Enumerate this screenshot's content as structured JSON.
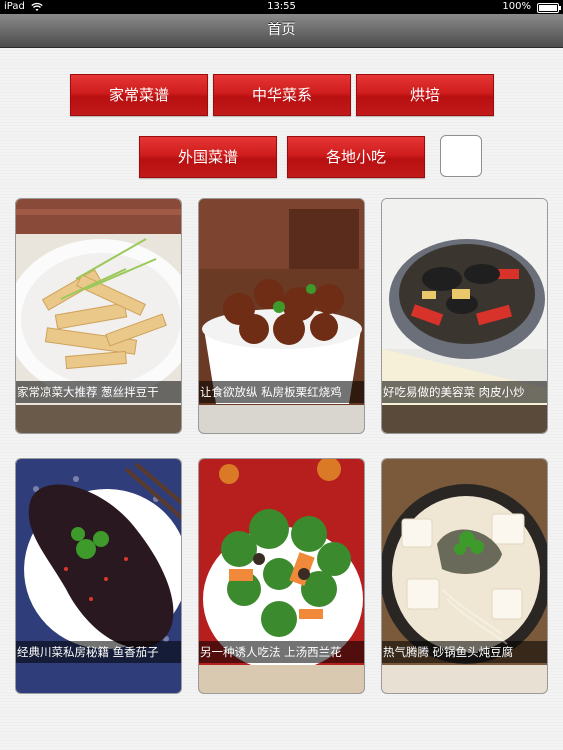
{
  "status_bar": {
    "device": "iPad",
    "time": "13:55",
    "battery": "100%"
  },
  "nav": {
    "title": "首页"
  },
  "categories": [
    {
      "label": "家常菜谱"
    },
    {
      "label": "中华菜系"
    },
    {
      "label": "烘培"
    },
    {
      "label": "外国菜谱"
    },
    {
      "label": "各地小吃"
    }
  ],
  "recipes": [
    {
      "title": "家常凉菜大推荐 葱丝拌豆干"
    },
    {
      "title": "让食欲放纵 私房板栗红烧鸡"
    },
    {
      "title": "好吃易做的美容菜 肉皮小炒"
    },
    {
      "title": "经典川菜私房秘籍 鱼香茄子"
    },
    {
      "title": "另一种诱人吃法 上汤西兰花"
    },
    {
      "title": "热气腾腾 砂锅鱼头炖豆腐"
    }
  ],
  "colors": {
    "category_red": "#cf1d1d",
    "nav_top": "#8a8a8a",
    "nav_bottom": "#4d4d4d"
  },
  "icons": {
    "wifi": "wifi-icon",
    "battery": "battery-icon",
    "bluetooth": "bluetooth-icon"
  }
}
